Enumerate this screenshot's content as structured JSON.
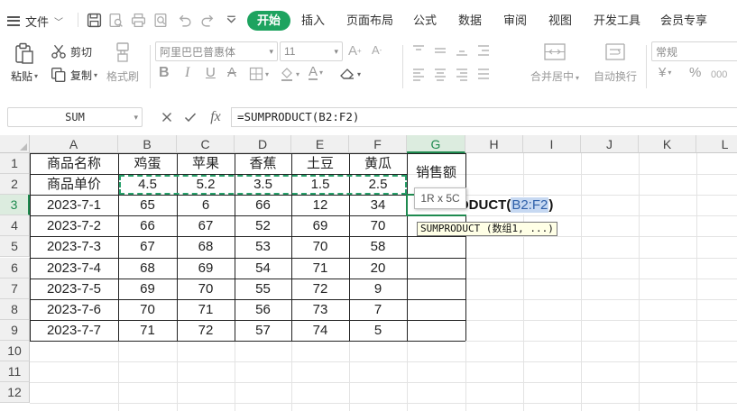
{
  "menu": {
    "file_label": "文件",
    "tabs": [
      "开始",
      "插入",
      "页面布局",
      "公式",
      "数据",
      "审阅",
      "视图",
      "开发工具",
      "会员专享"
    ],
    "active_tab": "开始"
  },
  "ribbon": {
    "cut": "剪切",
    "paste": "粘贴",
    "copy": "复制",
    "format_painter": "格式刷",
    "font_name": "阿里巴巴普惠体",
    "font_size": "11",
    "number_format": "常规",
    "merge_center": "合并居中",
    "wrap_text": "自动换行",
    "currency_symbol": "¥",
    "percent_symbol": "%"
  },
  "formula_bar": {
    "name_box": "SUM",
    "fx": "fx",
    "formula": "=SUMPRODUCT(B2:F2)"
  },
  "grid": {
    "columns": [
      "A",
      "B",
      "C",
      "D",
      "E",
      "F",
      "G",
      "H",
      "I",
      "J",
      "K",
      "L"
    ],
    "rows": [
      "1",
      "2",
      "3",
      "4",
      "5",
      "6",
      "7",
      "8",
      "9",
      "10",
      "11",
      "12"
    ],
    "selected_column": "G",
    "selected_row": "3",
    "cells": [
      [
        "商品名称",
        "鸡蛋",
        "苹果",
        "香蕉",
        "土豆",
        "黄瓜",
        "销售额"
      ],
      [
        "商品单价",
        "4.5",
        "5.2",
        "3.5",
        "1.5",
        "2.5",
        ""
      ],
      [
        "2023-7-1",
        "65",
        "6",
        "66",
        "12",
        "34",
        ""
      ],
      [
        "2023-7-2",
        "66",
        "67",
        "52",
        "69",
        "70",
        ""
      ],
      [
        "2023-7-3",
        "67",
        "68",
        "53",
        "70",
        "58",
        ""
      ],
      [
        "2023-7-4",
        "68",
        "69",
        "54",
        "71",
        "20",
        ""
      ],
      [
        "2023-7-5",
        "69",
        "70",
        "55",
        "72",
        "9",
        ""
      ],
      [
        "2023-7-6",
        "70",
        "71",
        "56",
        "73",
        "7",
        ""
      ],
      [
        "2023-7-7",
        "71",
        "72",
        "57",
        "74",
        "5",
        ""
      ]
    ],
    "edit_prefix": "ODUCT(",
    "edit_ref": "B2:F2",
    "edit_suffix": ")",
    "tooltip_size": "1R x 5C",
    "tooltip_func": "SUMPRODUCT (数组1, ...)"
  },
  "colors": {
    "accent": "#1da35f",
    "selection": "#1e8a4f",
    "marquee": "#27a06a",
    "ref_highlight": "#c7d9f2"
  },
  "icons": [
    "menu-icon",
    "save-icon",
    "print-preview-icon",
    "print-icon",
    "zoom-icon",
    "undo-icon",
    "redo-icon",
    "more-icon",
    "cut-icon",
    "paste-icon",
    "copy-icon",
    "format-painter-icon",
    "bold-icon",
    "italic-icon",
    "underline-icon",
    "border-icon",
    "fill-color-icon",
    "font-color-icon",
    "clear-icon",
    "merge-icon",
    "wrap-icon",
    "cancel-icon",
    "confirm-icon"
  ]
}
